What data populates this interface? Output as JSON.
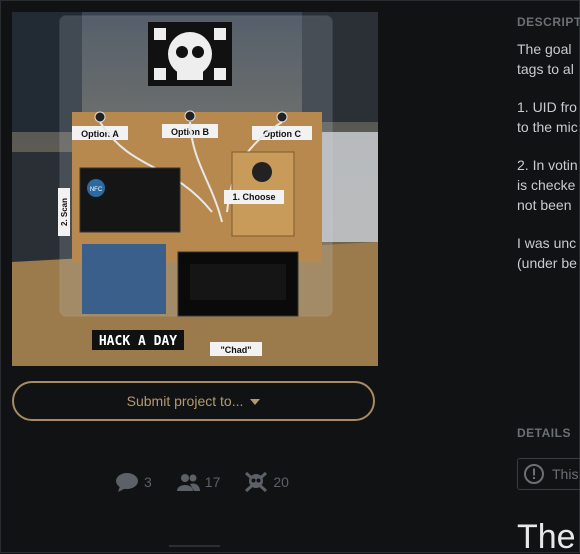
{
  "project": {
    "photo_alt": "Hackaday voting machine project photo",
    "photo_labels": {
      "option_a": "Option A",
      "option_b": "Option B",
      "option_c": "Option C",
      "choose": "1. Choose",
      "scan": "2. Scan",
      "nfc": "NFC",
      "hackaday_sign": "HACK A DAY",
      "chad": "\"Chad\""
    },
    "submit_label": "Submit project to...",
    "stats": {
      "comments": "3",
      "followers": "17",
      "skulls": "20"
    }
  },
  "sidebar": {
    "description_heading": "DESCRIPTION",
    "description_lines": [
      "The goal",
      "tags to al",
      "1. UID fro",
      "to the mic",
      "2. In votin",
      "is checke",
      "not been",
      "I was unc",
      "(under be"
    ],
    "details_heading": "DETAILS",
    "notice_text": "This",
    "main_heading": "The"
  },
  "colors": {
    "background": "#101214",
    "accent_gold": "#b49a6d",
    "muted": "#5b6167"
  }
}
